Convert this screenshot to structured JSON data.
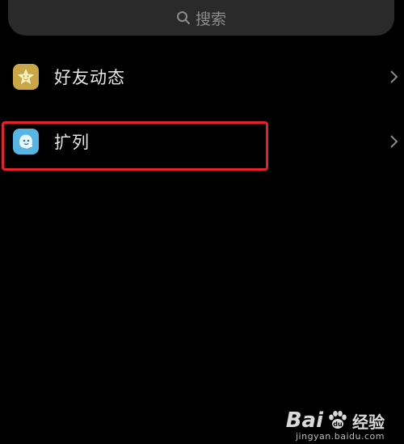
{
  "search": {
    "label": "搜索",
    "icon": "search-icon"
  },
  "items": [
    {
      "label": "好友动态",
      "icon": "star-face-icon",
      "icon_color": "#c9a646",
      "chevron": "chevron-right-icon"
    },
    {
      "label": "扩列",
      "icon": "blob-face-icon",
      "icon_color": "#55b6e3",
      "chevron": "chevron-right-icon"
    }
  ],
  "highlight": {
    "color": "#e8202a"
  },
  "watermark": {
    "brand_left": "Bai",
    "brand_right": "经验",
    "url": "jingyan.baidu.com"
  }
}
